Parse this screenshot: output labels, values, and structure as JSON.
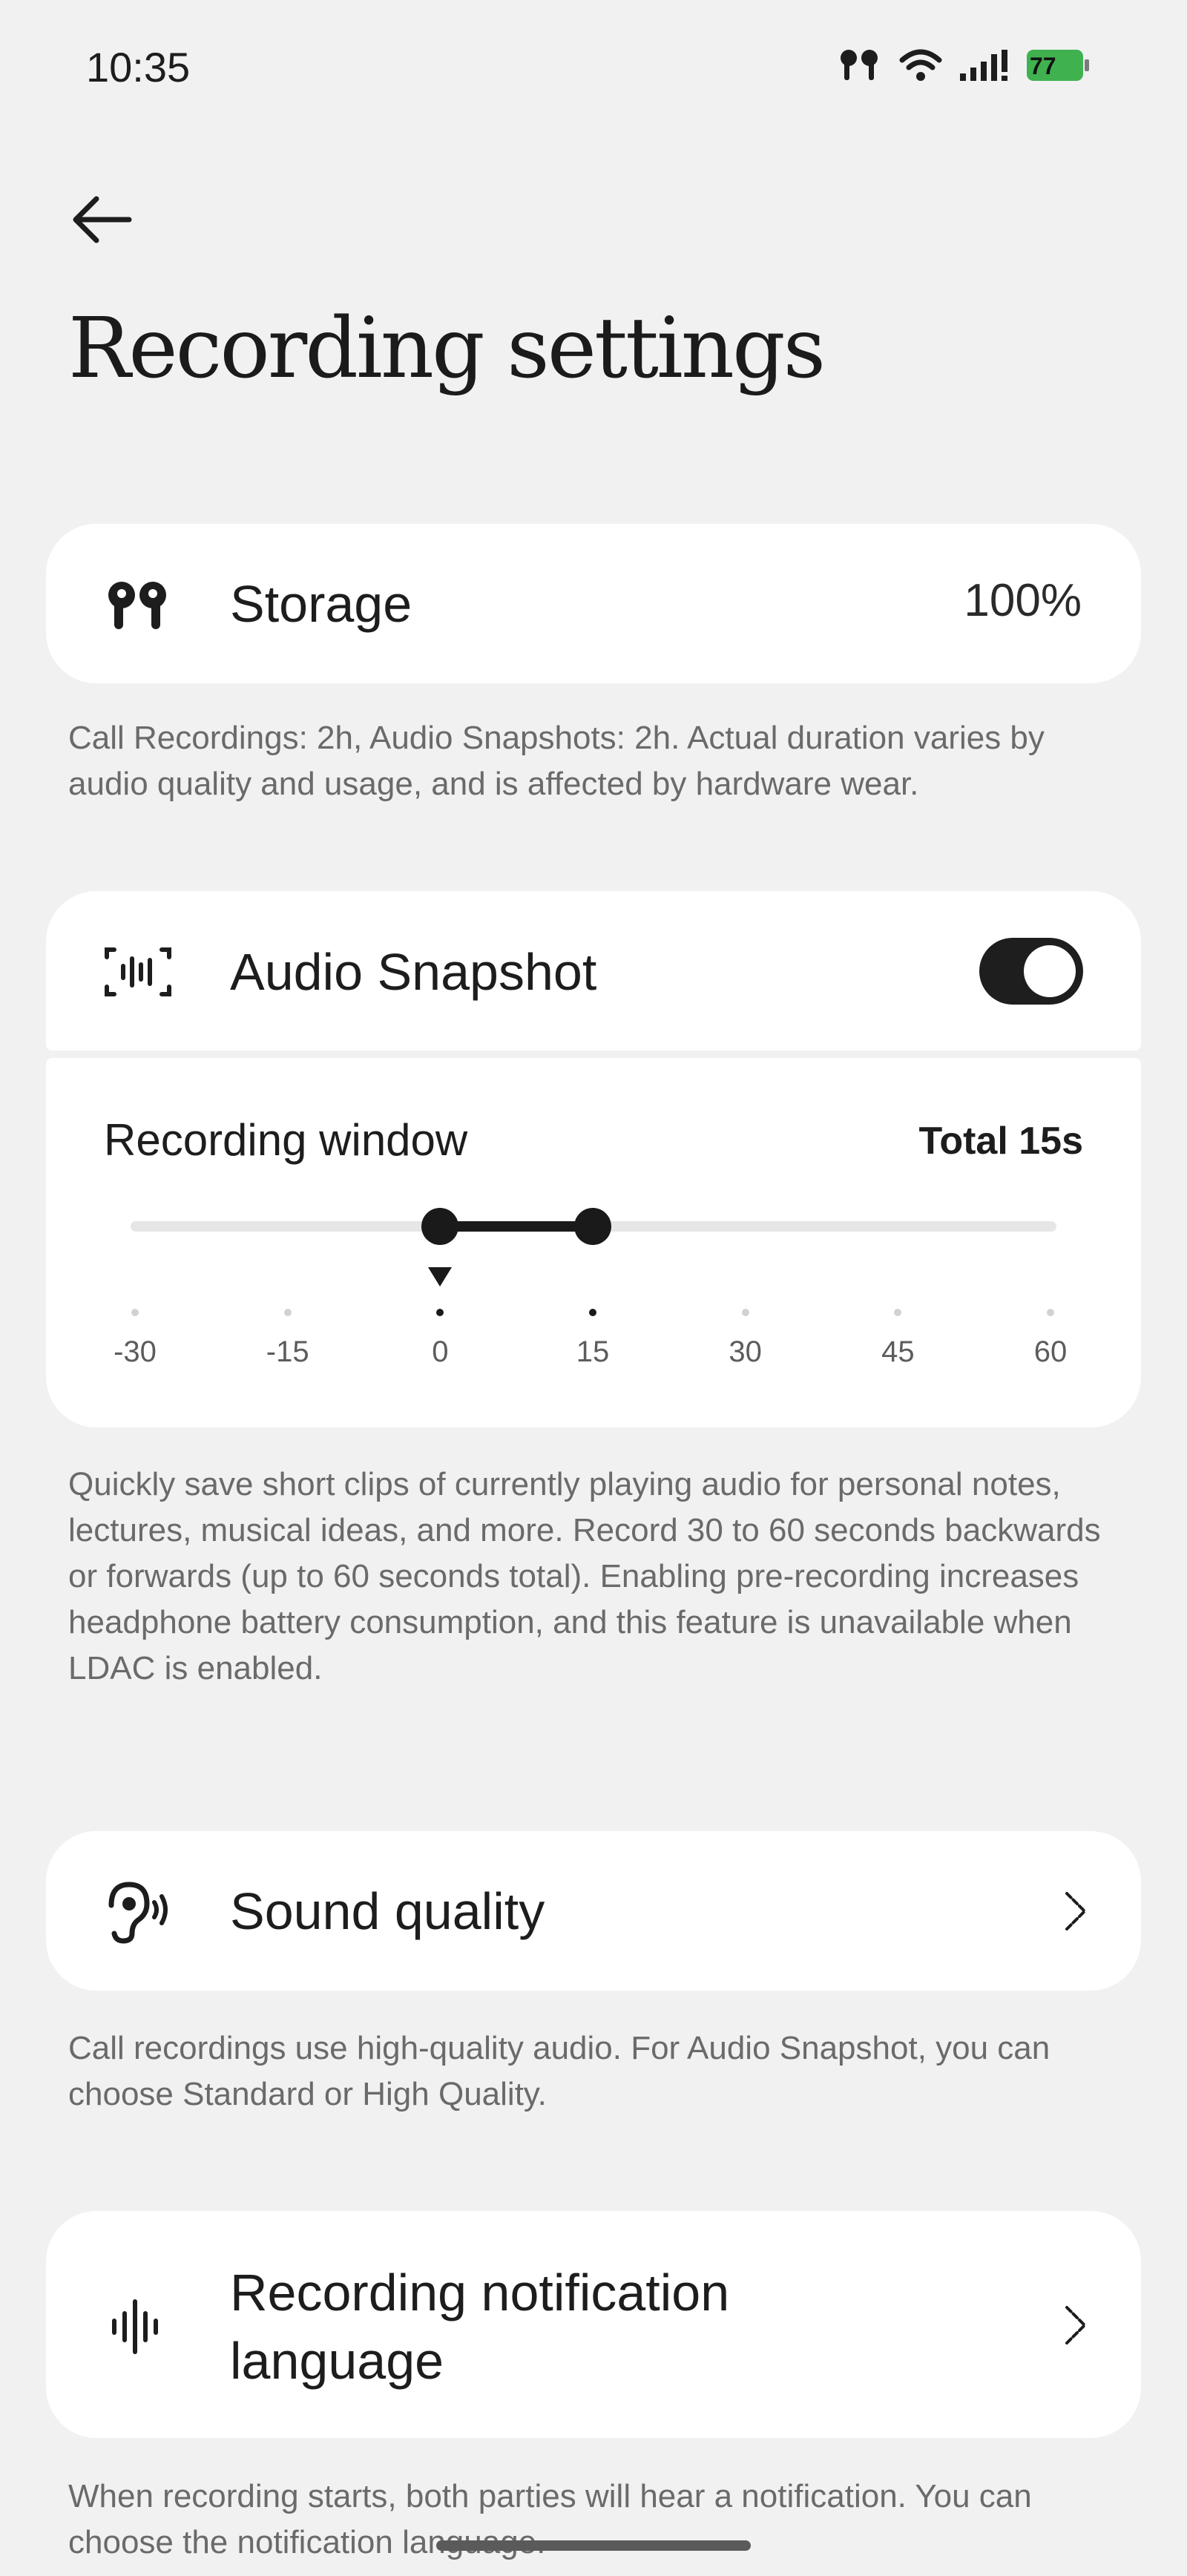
{
  "status_bar": {
    "time": "10:35",
    "battery_level": "77",
    "battery_color": "#3fb24f"
  },
  "header": {
    "back_icon": "arrow-left-icon",
    "title": "Recording settings"
  },
  "storage": {
    "icon": "earbuds-icon",
    "label": "Storage",
    "value": "100%",
    "description": "Call Recordings: 2h, Audio Snapshots: 2h. Actual duration varies by audio quality and usage, and is affected by hardware wear."
  },
  "audio_snapshot": {
    "icon": "audio-snapshot-icon",
    "label": "Audio Snapshot",
    "enabled": true,
    "recording_window": {
      "label": "Recording window",
      "total": "Total 15s",
      "range_start": 0,
      "range_end": 15,
      "ticks": [
        "-30",
        "-15",
        "0",
        "15",
        "30",
        "45",
        "60"
      ]
    },
    "description": "Quickly save short clips of currently playing audio for personal notes, lectures, musical ideas, and more. Record 30 to 60 seconds backwards or forwards (up to 60 seconds total). Enabling pre-recording increases headphone battery consumption, and this feature is unavailable when LDAC is enabled."
  },
  "sound_quality": {
    "icon": "ear-sound-icon",
    "label": "Sound quality",
    "description": "Call recordings use high-quality audio. For Audio Snapshot, you can choose Standard or High Quality."
  },
  "notification_language": {
    "icon": "waveform-icon",
    "label_line1": "Recording notification",
    "label_line2": "language",
    "description": "When recording starts, both parties will hear a notification. You can choose the notification language."
  }
}
